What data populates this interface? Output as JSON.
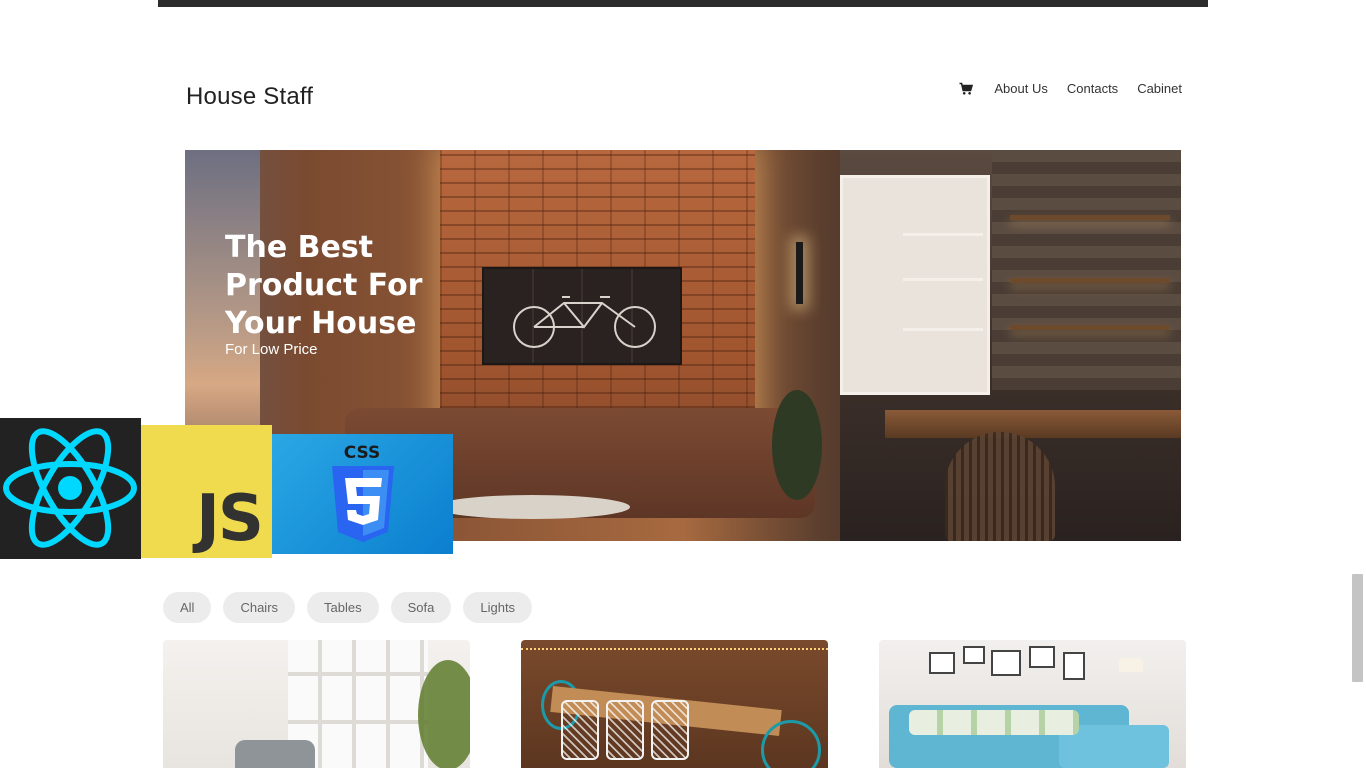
{
  "brand": {
    "title": "House Staff"
  },
  "nav": {
    "cart_icon": "shopping-cart-icon",
    "items": [
      {
        "label": "About Us"
      },
      {
        "label": "Contacts"
      },
      {
        "label": "Cabinet"
      }
    ]
  },
  "hero": {
    "headline": "The Best Product For Your House",
    "subheadline": "For Low Price"
  },
  "tech_logos": [
    {
      "name": "React",
      "icon": "react-logo-icon",
      "color": "#61dafb"
    },
    {
      "name": "JS",
      "icon": "javascript-logo-icon",
      "color": "#f0db4f"
    },
    {
      "name": "CSS",
      "icon": "css3-logo-icon",
      "color": "#1572b6"
    }
  ],
  "filters": [
    {
      "label": "All"
    },
    {
      "label": "Chairs"
    },
    {
      "label": "Tables"
    },
    {
      "label": "Sofa"
    },
    {
      "label": "Lights"
    }
  ],
  "products": [
    {
      "image": "chair-product-image"
    },
    {
      "image": "dining-table-product-image"
    },
    {
      "image": "sofa-product-image"
    }
  ],
  "colors": {
    "top_bar": "#2c2c2c",
    "chip_bg": "#ececec",
    "hero_text": "#ffffff"
  }
}
